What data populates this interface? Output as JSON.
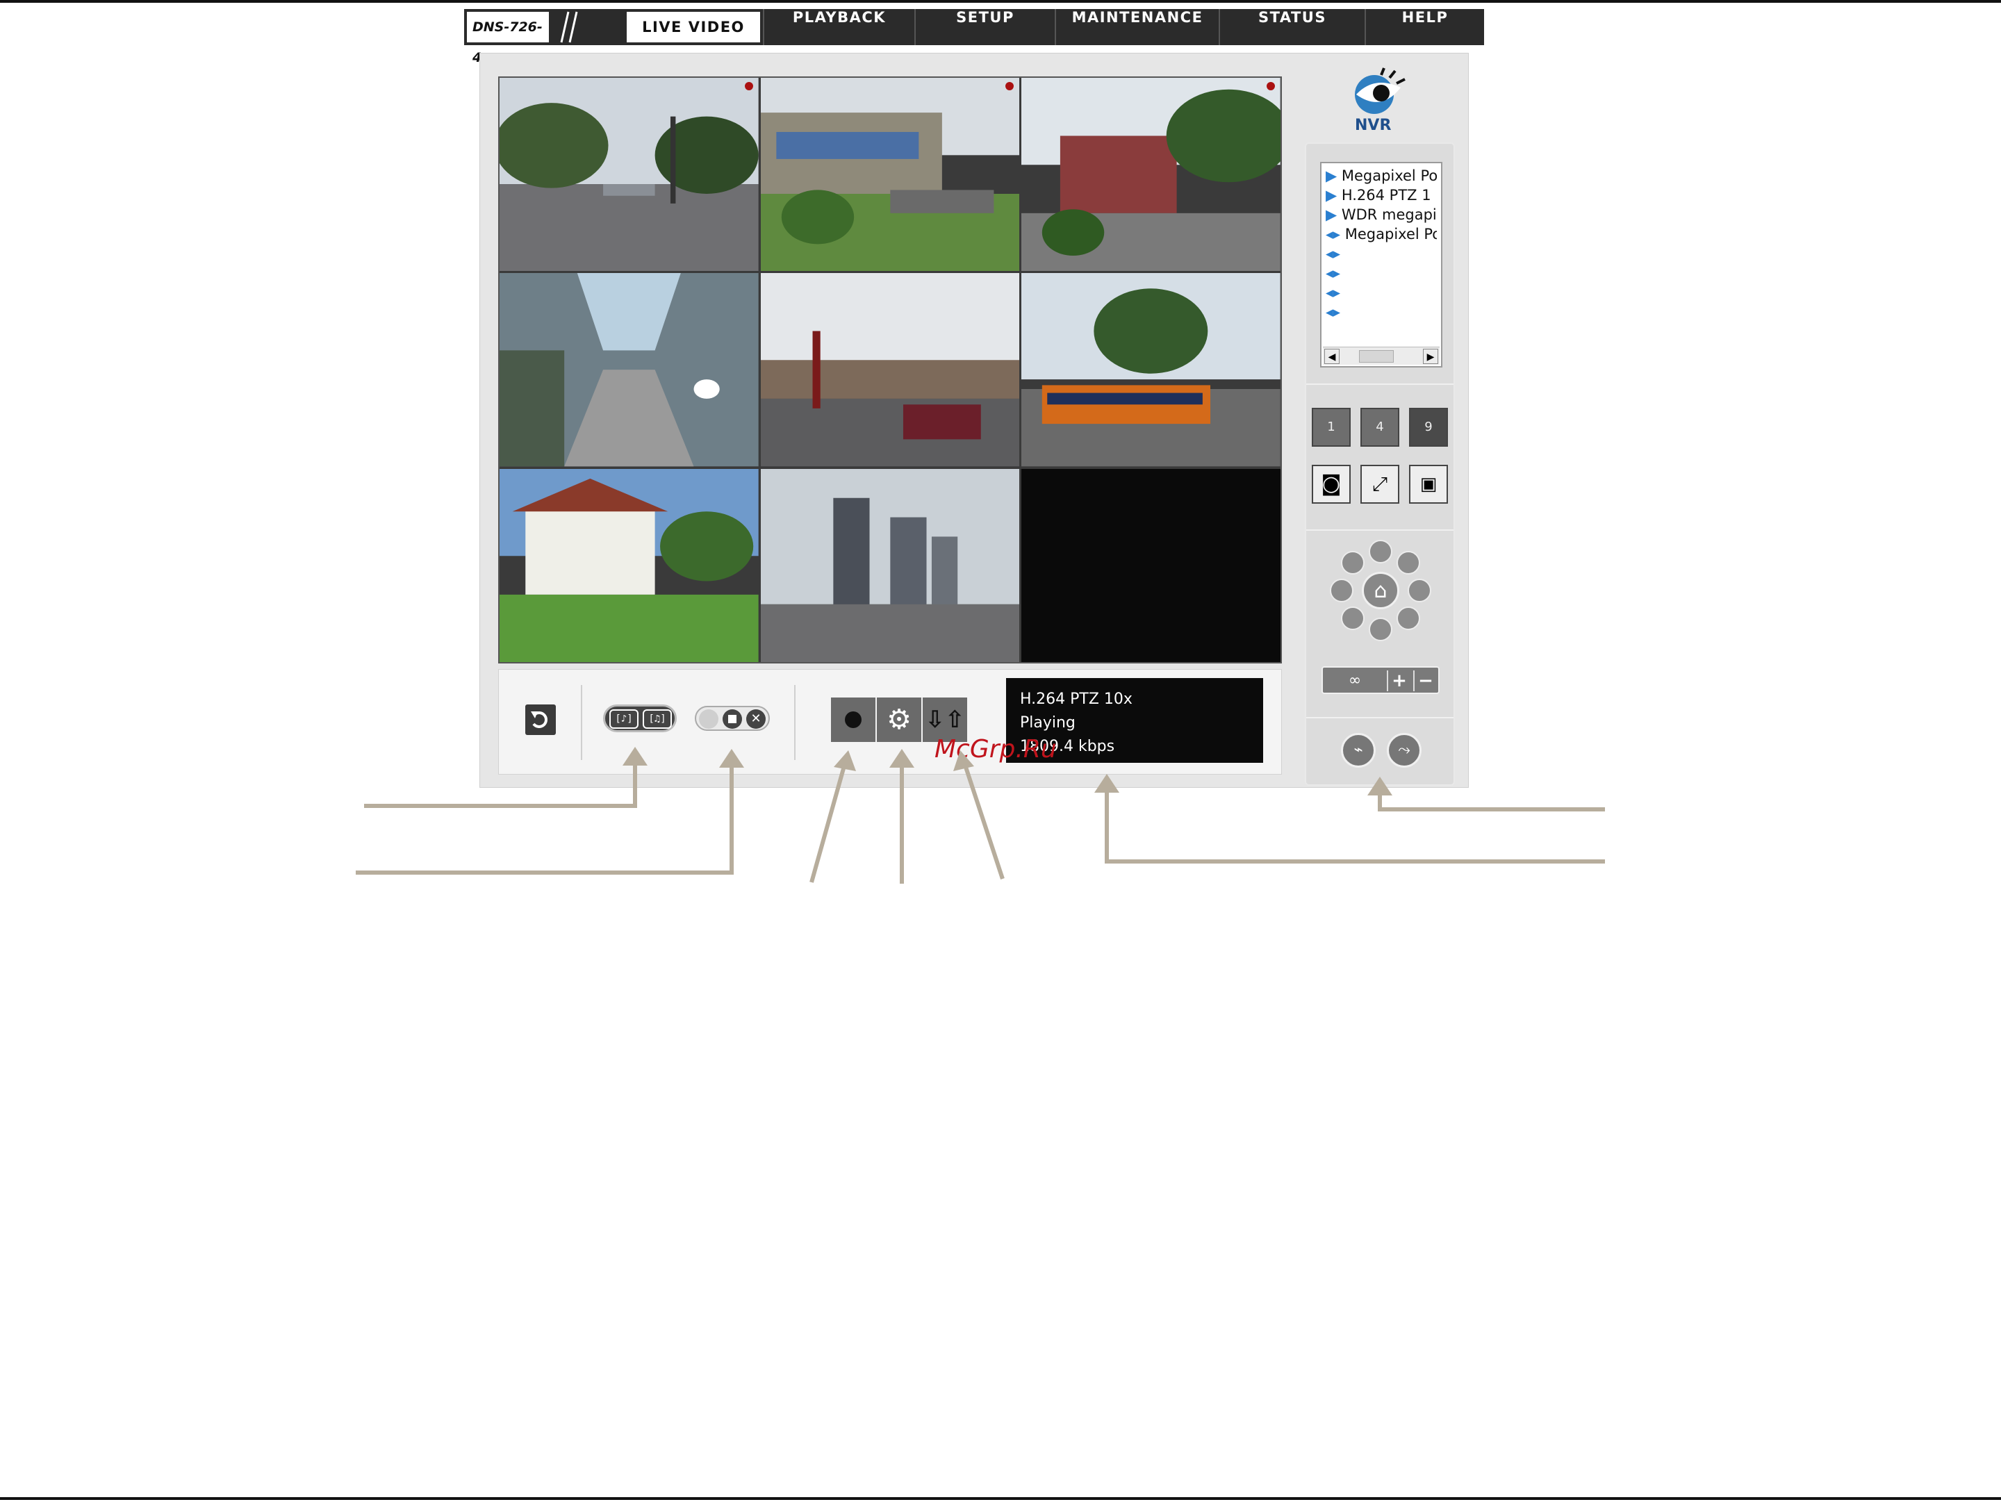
{
  "nav": {
    "model": "DNS-726-4",
    "tabs": [
      "LIVE VIDEO",
      "PLAYBACK",
      "SETUP",
      "MAINTENANCE",
      "STATUS",
      "HELP"
    ],
    "active_tab": "LIVE VIDEO"
  },
  "logo": {
    "text": "NVR"
  },
  "camera_list": {
    "items": [
      {
        "label": "Megapixel Po",
        "icon": "play-triangle-icon"
      },
      {
        "label": "H.264 PTZ 1",
        "icon": "play-triangle-icon"
      },
      {
        "label": "WDR megapi",
        "icon": "play-triangle-icon"
      },
      {
        "label": "Megapixel Po",
        "icon": "speaker-icon"
      },
      {
        "label": "",
        "icon": "speaker-icon"
      },
      {
        "label": "",
        "icon": "speaker-icon"
      },
      {
        "label": "",
        "icon": "speaker-icon"
      },
      {
        "label": "",
        "icon": "speaker-icon"
      }
    ]
  },
  "layout_buttons": [
    "1",
    "4",
    "9"
  ],
  "status": {
    "camera": "H.264 PTZ 10x",
    "state": "Playing",
    "bitrate": "1809.4 kbps"
  },
  "watermark": "McGrp.Ru",
  "colors": {
    "nav_bg": "#2b2b2b",
    "annotation": "#b7ad9c",
    "status_bg": "#0b0b0b"
  }
}
